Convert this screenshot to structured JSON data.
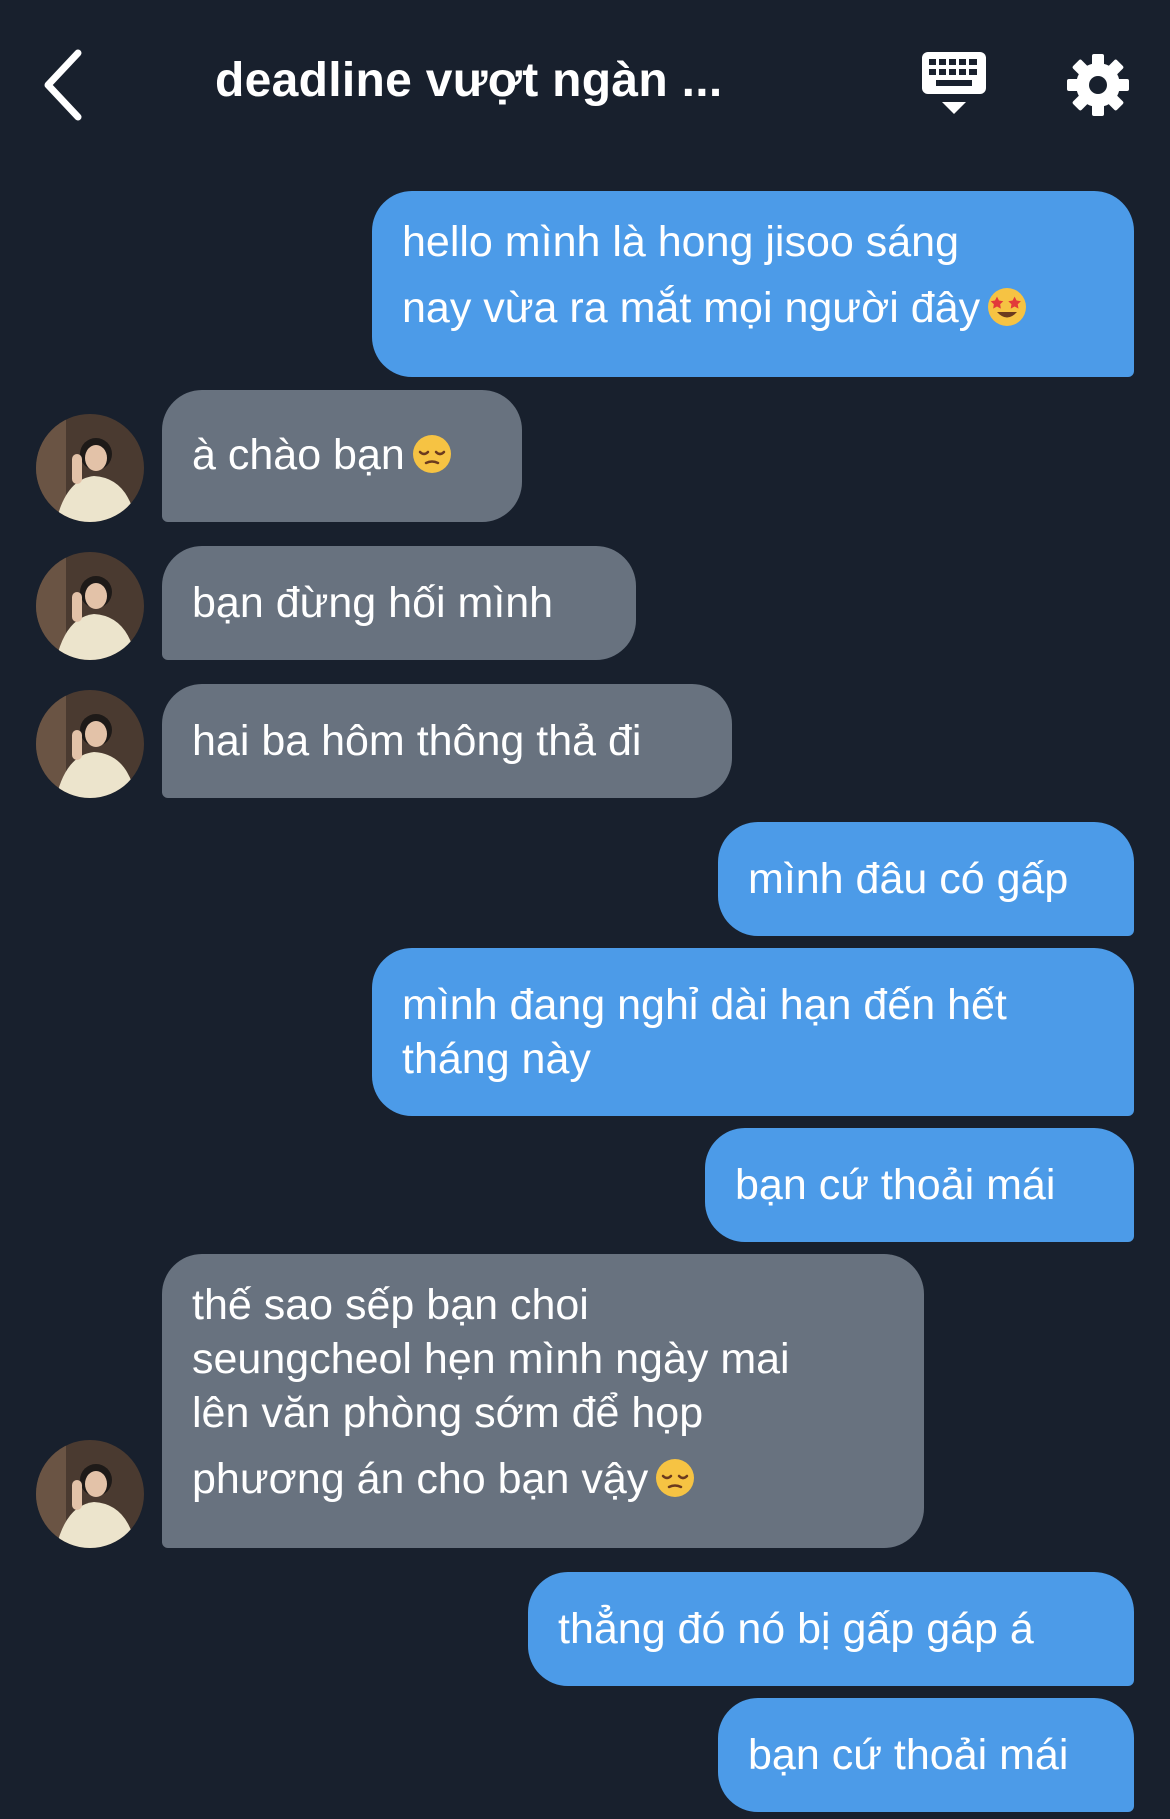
{
  "header": {
    "title": "deadline vượt ngàn ...",
    "back_icon": "chevron-left-icon",
    "keyboard_icon": "keyboard-icon",
    "settings_icon": "gear-icon"
  },
  "colors": {
    "background": "#18202d",
    "outgoing_bubble": "#4c9be8",
    "incoming_bubble": "#68727f",
    "text": "#ffffff"
  },
  "messages": [
    {
      "side": "out",
      "lines": [
        "hello mình là hong jisoo sáng",
        "nay vừa ra mắt mọi người đây"
      ],
      "emoji": "star-struck-emoji"
    },
    {
      "side": "in",
      "lines": [
        "à chào bạn"
      ],
      "emoji": "pensive-face-emoji"
    },
    {
      "side": "in",
      "lines": [
        "bạn đừng hối mình"
      ]
    },
    {
      "side": "in",
      "lines": [
        "hai ba hôm thông thả đi"
      ]
    },
    {
      "side": "out",
      "lines": [
        "mình đâu có gấp"
      ]
    },
    {
      "side": "out",
      "lines": [
        "mình đang nghỉ dài hạn đến hết",
        "tháng này"
      ]
    },
    {
      "side": "out",
      "lines": [
        "bạn cứ thoải mái"
      ]
    },
    {
      "side": "in",
      "lines": [
        "thế sao sếp bạn choi",
        "seungcheol hẹn mình ngày mai",
        "lên văn phòng sớm để họp",
        "phương án cho bạn vậy"
      ],
      "emoji": "pensive-face-emoji"
    },
    {
      "side": "out",
      "lines": [
        "thẳng đó nó bị gấp gáp á"
      ]
    },
    {
      "side": "out",
      "lines": [
        "bạn cứ thoải mái"
      ]
    }
  ]
}
